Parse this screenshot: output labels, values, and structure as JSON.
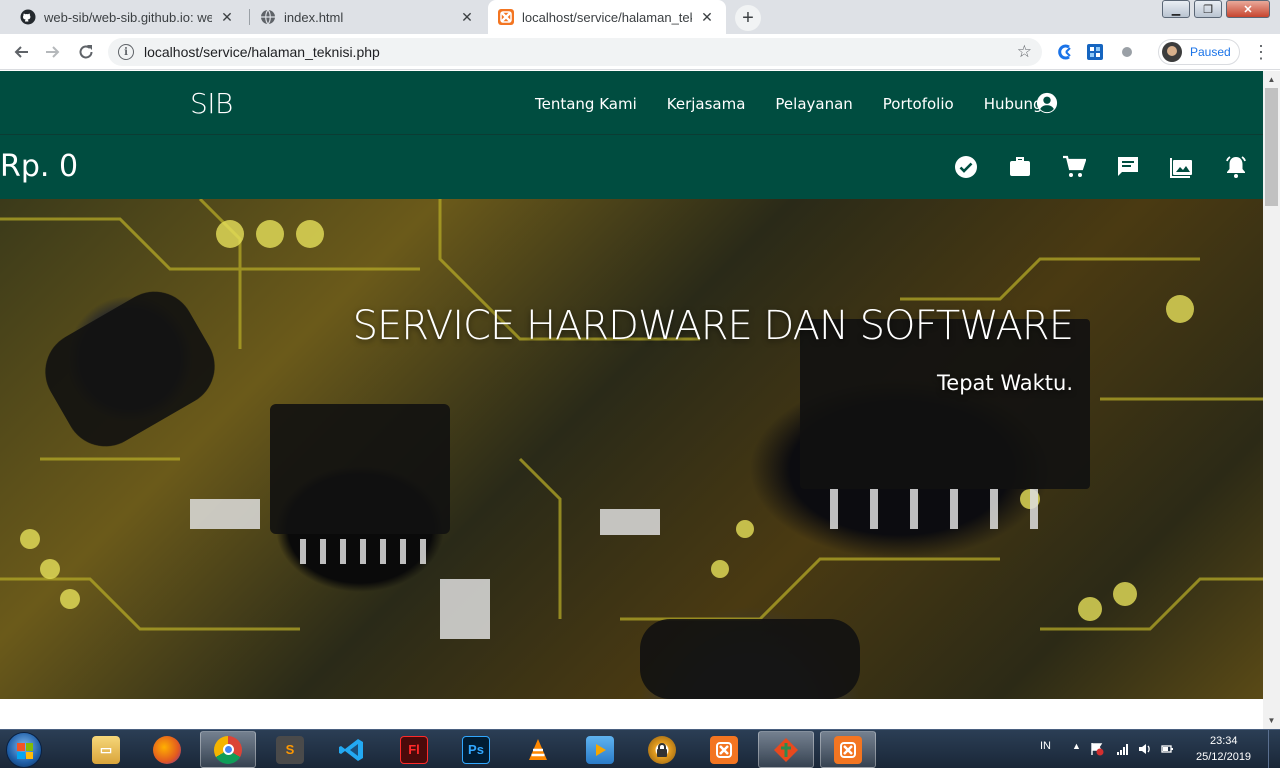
{
  "browser": {
    "tabs": [
      {
        "title": "web-sib/web-sib.github.io: websi",
        "favicon": "github-icon",
        "active": false
      },
      {
        "title": "index.html",
        "favicon": "globe-icon",
        "active": false
      },
      {
        "title": "localhost/service/halaman_teknis",
        "favicon": "xampp-icon",
        "active": true
      }
    ],
    "url": "localhost/service/halaman_teknisi.php",
    "profile_status": "Paused"
  },
  "page": {
    "brand": "SIB",
    "nav": [
      "Tentang Kami",
      "Kerjasama",
      "Pelayanan",
      "Portofolio",
      "Hubungi"
    ],
    "balance": "Rp. 0",
    "subbar_icons": [
      "check-circle-icon",
      "briefcase-icon",
      "cart-icon",
      "chat-icon",
      "photos-icon",
      "alarm-bell-icon"
    ],
    "hero": {
      "title": "SERVICE HARDWARE DAN SOFTWARE",
      "subtitle": "Tepat Waktu."
    },
    "colors": {
      "navbar": "#004d40",
      "text": "#ffffff"
    }
  },
  "taskbar": {
    "apps": [
      "explorer-icon",
      "firefox-icon",
      "chrome-icon",
      "sublime-icon",
      "vscode-icon",
      "flash-icon",
      "photoshop-icon",
      "vlc-icon",
      "video-player-icon",
      "keepass-icon",
      "xampp-icon",
      "git-icon",
      "xampp-icon"
    ],
    "language": "IN",
    "time": "23:34",
    "date": "25/12/2019"
  }
}
